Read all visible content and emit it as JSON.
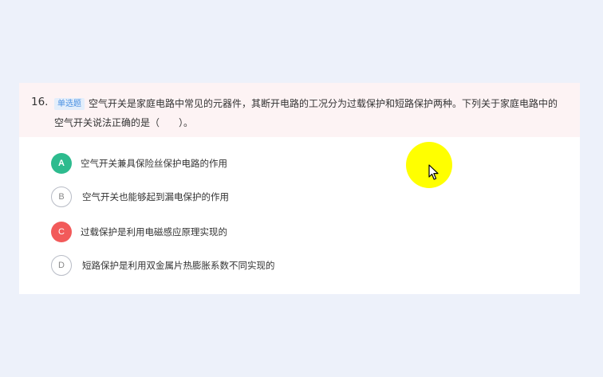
{
  "question": {
    "number": "16.",
    "type_label": "单选题",
    "text": "空气开关是家庭电路中常见的元器件，其断开电路的工况分为过载保护和短路保护两种。下列关于家庭电路中的空气开关说法正确的是（　　）。"
  },
  "options": [
    {
      "letter": "A",
      "text": "空气开关兼具保险丝保护电路的作用",
      "state": "correct",
      "color": "#2dbb8e"
    },
    {
      "letter": "B",
      "text": "空气开关也能够起到漏电保护的作用",
      "state": "unselected"
    },
    {
      "letter": "C",
      "text": "过载保护是利用电磁感应原理实现的",
      "state": "wrong",
      "color": "#f25a5a"
    },
    {
      "letter": "D",
      "text": "短路保护是利用双金属片热膨胀系数不同实现的",
      "state": "unselected"
    }
  ],
  "cursor": {
    "icon": "mouse-pointer-icon",
    "highlight_color": "#ffff00"
  }
}
